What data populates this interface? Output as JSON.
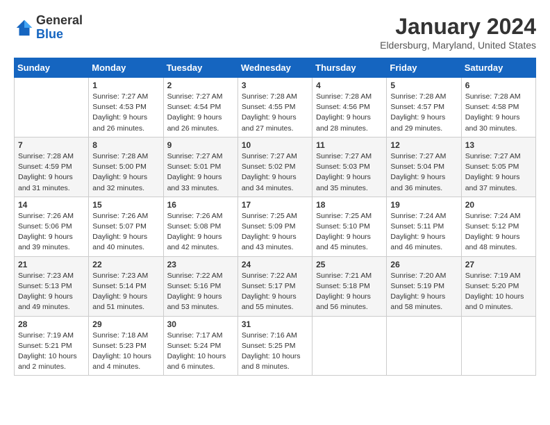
{
  "logo": {
    "general": "General",
    "blue": "Blue"
  },
  "header": {
    "month": "January 2024",
    "location": "Eldersburg, Maryland, United States"
  },
  "weekdays": [
    "Sunday",
    "Monday",
    "Tuesday",
    "Wednesday",
    "Thursday",
    "Friday",
    "Saturday"
  ],
  "weeks": [
    [
      {
        "day": "",
        "info": ""
      },
      {
        "day": "1",
        "info": "Sunrise: 7:27 AM\nSunset: 4:53 PM\nDaylight: 9 hours\nand 26 minutes."
      },
      {
        "day": "2",
        "info": "Sunrise: 7:27 AM\nSunset: 4:54 PM\nDaylight: 9 hours\nand 26 minutes."
      },
      {
        "day": "3",
        "info": "Sunrise: 7:28 AM\nSunset: 4:55 PM\nDaylight: 9 hours\nand 27 minutes."
      },
      {
        "day": "4",
        "info": "Sunrise: 7:28 AM\nSunset: 4:56 PM\nDaylight: 9 hours\nand 28 minutes."
      },
      {
        "day": "5",
        "info": "Sunrise: 7:28 AM\nSunset: 4:57 PM\nDaylight: 9 hours\nand 29 minutes."
      },
      {
        "day": "6",
        "info": "Sunrise: 7:28 AM\nSunset: 4:58 PM\nDaylight: 9 hours\nand 30 minutes."
      }
    ],
    [
      {
        "day": "7",
        "info": "Sunrise: 7:28 AM\nSunset: 4:59 PM\nDaylight: 9 hours\nand 31 minutes."
      },
      {
        "day": "8",
        "info": "Sunrise: 7:28 AM\nSunset: 5:00 PM\nDaylight: 9 hours\nand 32 minutes."
      },
      {
        "day": "9",
        "info": "Sunrise: 7:27 AM\nSunset: 5:01 PM\nDaylight: 9 hours\nand 33 minutes."
      },
      {
        "day": "10",
        "info": "Sunrise: 7:27 AM\nSunset: 5:02 PM\nDaylight: 9 hours\nand 34 minutes."
      },
      {
        "day": "11",
        "info": "Sunrise: 7:27 AM\nSunset: 5:03 PM\nDaylight: 9 hours\nand 35 minutes."
      },
      {
        "day": "12",
        "info": "Sunrise: 7:27 AM\nSunset: 5:04 PM\nDaylight: 9 hours\nand 36 minutes."
      },
      {
        "day": "13",
        "info": "Sunrise: 7:27 AM\nSunset: 5:05 PM\nDaylight: 9 hours\nand 37 minutes."
      }
    ],
    [
      {
        "day": "14",
        "info": "Sunrise: 7:26 AM\nSunset: 5:06 PM\nDaylight: 9 hours\nand 39 minutes."
      },
      {
        "day": "15",
        "info": "Sunrise: 7:26 AM\nSunset: 5:07 PM\nDaylight: 9 hours\nand 40 minutes."
      },
      {
        "day": "16",
        "info": "Sunrise: 7:26 AM\nSunset: 5:08 PM\nDaylight: 9 hours\nand 42 minutes."
      },
      {
        "day": "17",
        "info": "Sunrise: 7:25 AM\nSunset: 5:09 PM\nDaylight: 9 hours\nand 43 minutes."
      },
      {
        "day": "18",
        "info": "Sunrise: 7:25 AM\nSunset: 5:10 PM\nDaylight: 9 hours\nand 45 minutes."
      },
      {
        "day": "19",
        "info": "Sunrise: 7:24 AM\nSunset: 5:11 PM\nDaylight: 9 hours\nand 46 minutes."
      },
      {
        "day": "20",
        "info": "Sunrise: 7:24 AM\nSunset: 5:12 PM\nDaylight: 9 hours\nand 48 minutes."
      }
    ],
    [
      {
        "day": "21",
        "info": "Sunrise: 7:23 AM\nSunset: 5:13 PM\nDaylight: 9 hours\nand 49 minutes."
      },
      {
        "day": "22",
        "info": "Sunrise: 7:23 AM\nSunset: 5:14 PM\nDaylight: 9 hours\nand 51 minutes."
      },
      {
        "day": "23",
        "info": "Sunrise: 7:22 AM\nSunset: 5:16 PM\nDaylight: 9 hours\nand 53 minutes."
      },
      {
        "day": "24",
        "info": "Sunrise: 7:22 AM\nSunset: 5:17 PM\nDaylight: 9 hours\nand 55 minutes."
      },
      {
        "day": "25",
        "info": "Sunrise: 7:21 AM\nSunset: 5:18 PM\nDaylight: 9 hours\nand 56 minutes."
      },
      {
        "day": "26",
        "info": "Sunrise: 7:20 AM\nSunset: 5:19 PM\nDaylight: 9 hours\nand 58 minutes."
      },
      {
        "day": "27",
        "info": "Sunrise: 7:19 AM\nSunset: 5:20 PM\nDaylight: 10 hours\nand 0 minutes."
      }
    ],
    [
      {
        "day": "28",
        "info": "Sunrise: 7:19 AM\nSunset: 5:21 PM\nDaylight: 10 hours\nand 2 minutes."
      },
      {
        "day": "29",
        "info": "Sunrise: 7:18 AM\nSunset: 5:23 PM\nDaylight: 10 hours\nand 4 minutes."
      },
      {
        "day": "30",
        "info": "Sunrise: 7:17 AM\nSunset: 5:24 PM\nDaylight: 10 hours\nand 6 minutes."
      },
      {
        "day": "31",
        "info": "Sunrise: 7:16 AM\nSunset: 5:25 PM\nDaylight: 10 hours\nand 8 minutes."
      },
      {
        "day": "",
        "info": ""
      },
      {
        "day": "",
        "info": ""
      },
      {
        "day": "",
        "info": ""
      }
    ]
  ]
}
